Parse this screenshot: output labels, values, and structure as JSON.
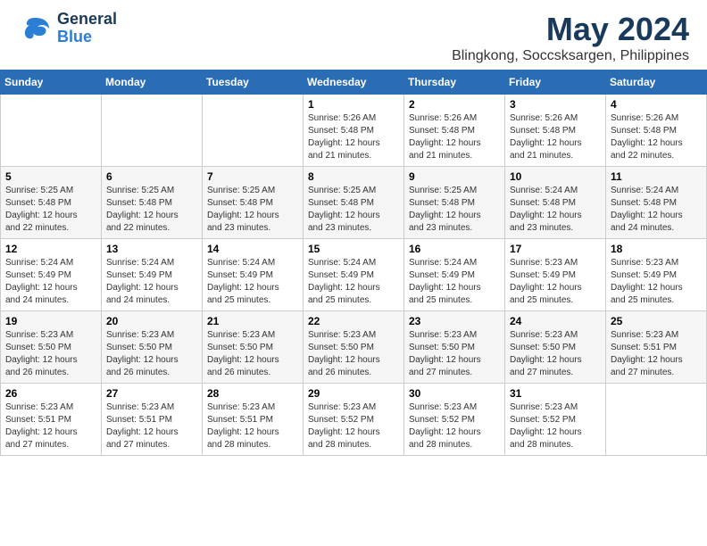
{
  "header": {
    "logo_general": "General",
    "logo_blue": "Blue",
    "month_year": "May 2024",
    "location": "Blingkong, Soccsksargen, Philippines"
  },
  "weekdays": [
    "Sunday",
    "Monday",
    "Tuesday",
    "Wednesday",
    "Thursday",
    "Friday",
    "Saturday"
  ],
  "weeks": [
    [
      {
        "day": "",
        "info": ""
      },
      {
        "day": "",
        "info": ""
      },
      {
        "day": "",
        "info": ""
      },
      {
        "day": "1",
        "info": "Sunrise: 5:26 AM\nSunset: 5:48 PM\nDaylight: 12 hours\nand 21 minutes."
      },
      {
        "day": "2",
        "info": "Sunrise: 5:26 AM\nSunset: 5:48 PM\nDaylight: 12 hours\nand 21 minutes."
      },
      {
        "day": "3",
        "info": "Sunrise: 5:26 AM\nSunset: 5:48 PM\nDaylight: 12 hours\nand 21 minutes."
      },
      {
        "day": "4",
        "info": "Sunrise: 5:26 AM\nSunset: 5:48 PM\nDaylight: 12 hours\nand 22 minutes."
      }
    ],
    [
      {
        "day": "5",
        "info": "Sunrise: 5:25 AM\nSunset: 5:48 PM\nDaylight: 12 hours\nand 22 minutes."
      },
      {
        "day": "6",
        "info": "Sunrise: 5:25 AM\nSunset: 5:48 PM\nDaylight: 12 hours\nand 22 minutes."
      },
      {
        "day": "7",
        "info": "Sunrise: 5:25 AM\nSunset: 5:48 PM\nDaylight: 12 hours\nand 23 minutes."
      },
      {
        "day": "8",
        "info": "Sunrise: 5:25 AM\nSunset: 5:48 PM\nDaylight: 12 hours\nand 23 minutes."
      },
      {
        "day": "9",
        "info": "Sunrise: 5:25 AM\nSunset: 5:48 PM\nDaylight: 12 hours\nand 23 minutes."
      },
      {
        "day": "10",
        "info": "Sunrise: 5:24 AM\nSunset: 5:48 PM\nDaylight: 12 hours\nand 23 minutes."
      },
      {
        "day": "11",
        "info": "Sunrise: 5:24 AM\nSunset: 5:48 PM\nDaylight: 12 hours\nand 24 minutes."
      }
    ],
    [
      {
        "day": "12",
        "info": "Sunrise: 5:24 AM\nSunset: 5:49 PM\nDaylight: 12 hours\nand 24 minutes."
      },
      {
        "day": "13",
        "info": "Sunrise: 5:24 AM\nSunset: 5:49 PM\nDaylight: 12 hours\nand 24 minutes."
      },
      {
        "day": "14",
        "info": "Sunrise: 5:24 AM\nSunset: 5:49 PM\nDaylight: 12 hours\nand 25 minutes."
      },
      {
        "day": "15",
        "info": "Sunrise: 5:24 AM\nSunset: 5:49 PM\nDaylight: 12 hours\nand 25 minutes."
      },
      {
        "day": "16",
        "info": "Sunrise: 5:24 AM\nSunset: 5:49 PM\nDaylight: 12 hours\nand 25 minutes."
      },
      {
        "day": "17",
        "info": "Sunrise: 5:23 AM\nSunset: 5:49 PM\nDaylight: 12 hours\nand 25 minutes."
      },
      {
        "day": "18",
        "info": "Sunrise: 5:23 AM\nSunset: 5:49 PM\nDaylight: 12 hours\nand 25 minutes."
      }
    ],
    [
      {
        "day": "19",
        "info": "Sunrise: 5:23 AM\nSunset: 5:50 PM\nDaylight: 12 hours\nand 26 minutes."
      },
      {
        "day": "20",
        "info": "Sunrise: 5:23 AM\nSunset: 5:50 PM\nDaylight: 12 hours\nand 26 minutes."
      },
      {
        "day": "21",
        "info": "Sunrise: 5:23 AM\nSunset: 5:50 PM\nDaylight: 12 hours\nand 26 minutes."
      },
      {
        "day": "22",
        "info": "Sunrise: 5:23 AM\nSunset: 5:50 PM\nDaylight: 12 hours\nand 26 minutes."
      },
      {
        "day": "23",
        "info": "Sunrise: 5:23 AM\nSunset: 5:50 PM\nDaylight: 12 hours\nand 27 minutes."
      },
      {
        "day": "24",
        "info": "Sunrise: 5:23 AM\nSunset: 5:50 PM\nDaylight: 12 hours\nand 27 minutes."
      },
      {
        "day": "25",
        "info": "Sunrise: 5:23 AM\nSunset: 5:51 PM\nDaylight: 12 hours\nand 27 minutes."
      }
    ],
    [
      {
        "day": "26",
        "info": "Sunrise: 5:23 AM\nSunset: 5:51 PM\nDaylight: 12 hours\nand 27 minutes."
      },
      {
        "day": "27",
        "info": "Sunrise: 5:23 AM\nSunset: 5:51 PM\nDaylight: 12 hours\nand 27 minutes."
      },
      {
        "day": "28",
        "info": "Sunrise: 5:23 AM\nSunset: 5:51 PM\nDaylight: 12 hours\nand 28 minutes."
      },
      {
        "day": "29",
        "info": "Sunrise: 5:23 AM\nSunset: 5:52 PM\nDaylight: 12 hours\nand 28 minutes."
      },
      {
        "day": "30",
        "info": "Sunrise: 5:23 AM\nSunset: 5:52 PM\nDaylight: 12 hours\nand 28 minutes."
      },
      {
        "day": "31",
        "info": "Sunrise: 5:23 AM\nSunset: 5:52 PM\nDaylight: 12 hours\nand 28 minutes."
      },
      {
        "day": "",
        "info": ""
      }
    ]
  ]
}
